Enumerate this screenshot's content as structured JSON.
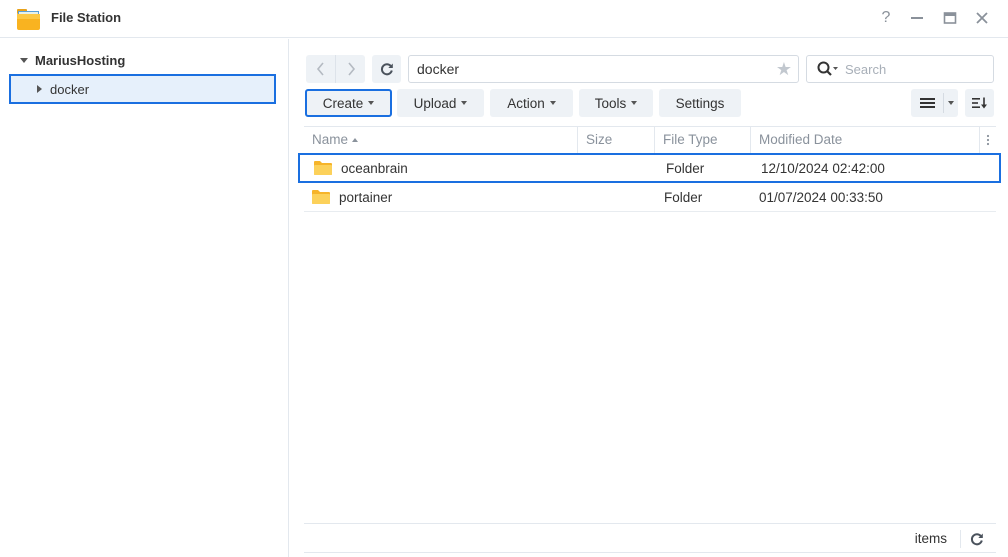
{
  "window": {
    "title": "File Station",
    "controls": {
      "help": "?",
      "minimize": "—",
      "close": "✕"
    }
  },
  "sidebar": {
    "root_label": "MariusHosting",
    "items": [
      {
        "label": "docker",
        "selected": true
      }
    ]
  },
  "toolbar": {
    "back_glyph": "‹",
    "forward_glyph": "›",
    "path_value": "docker",
    "star_glyph": "★",
    "search_placeholder": "Search",
    "buttons": {
      "create": "Create",
      "upload": "Upload",
      "action": "Action",
      "tools": "Tools",
      "settings": "Settings"
    }
  },
  "grid": {
    "columns": {
      "name": "Name",
      "size": "Size",
      "file_type": "File Type",
      "modified": "Modified Date"
    },
    "rows": [
      {
        "name": "oceanbrain",
        "size": "",
        "type": "Folder",
        "modified": "12/10/2024 02:42:00",
        "selected": true
      },
      {
        "name": "portainer",
        "size": "",
        "type": "Folder",
        "modified": "01/07/2024 00:33:50",
        "selected": false
      }
    ]
  },
  "footer": {
    "items_label": "items"
  },
  "colors": {
    "accent": "#1a6fe0",
    "folder": "#fcc740",
    "button_bg": "#eef2f6"
  }
}
